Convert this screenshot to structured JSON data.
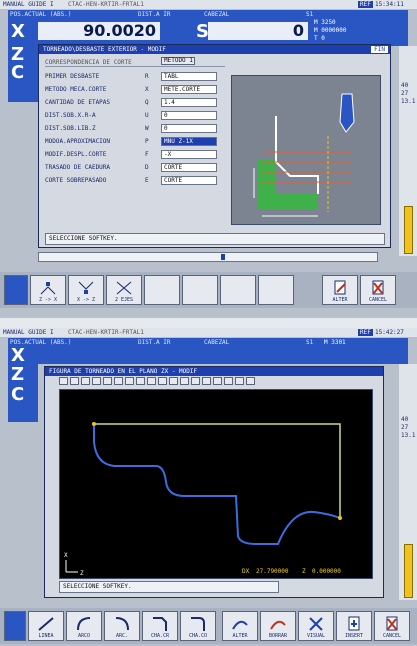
{
  "panel1": {
    "topbar": {
      "mode": "MANUAL GUIDE I",
      "program": "CTAC-HEN-KRTIR-FRTAL1",
      "badge": "REF",
      "time": "15:34:11"
    },
    "header": {
      "pos_label": "POS.ACTUAL (ABS.)",
      "dist_label": "DIST.A IR",
      "cabezal_label": "CABEZAL",
      "s_label": "S1",
      "x_axis": "X",
      "z_axis": "Z",
      "c_axis": "C",
      "x_value": "90.0020",
      "s_axis": "S",
      "s_value": "0",
      "s_info1": "M 3250",
      "s_info2": "M 0000000",
      "s_info3": "T 0"
    },
    "dialog": {
      "title": "TORNEADO\\DESBASTE EXTERIOR - MODIF",
      "title_badge": "FIN",
      "section": "CORRESPONDENCIA DE CORTE",
      "section_value": "METODO 1",
      "rows": [
        {
          "label": "PRIMER DESBASTE",
          "key": "R",
          "value": "TABL"
        },
        {
          "label": "METODO MECA.CORTE",
          "key": "X",
          "value": "METE.CORTE"
        },
        {
          "label": "CANTIDAD DE ETAPAS",
          "key": "Q",
          "value": "1.4"
        },
        {
          "label": "DIST.SOB.X.R-A",
          "key": "U",
          "value": "0"
        },
        {
          "label": "DIST.SOB.LIB.Z",
          "key": "W",
          "value": "0"
        },
        {
          "label": "MODOA.APROXIMACION",
          "key": "P",
          "value": "MNU Z-1X",
          "selected": true
        },
        {
          "label": "MODIF.DESPL.CORTE",
          "key": "F",
          "value": "-X"
        },
        {
          "label": "TRASADO DE CAEDURA",
          "key": "D",
          "value": "CORTE"
        },
        {
          "label": "CORTE SOBREPASADO",
          "key": "E",
          "value": "CORTE"
        }
      ],
      "status": "SELECCIONE SOFTKEY."
    },
    "side_numbers": [
      "40",
      "27",
      "13.1"
    ],
    "softkeys": [
      {
        "label": "Z -> X",
        "icon": "turn-z-x-icon"
      },
      {
        "label": "X -> Z",
        "icon": "turn-x-z-icon"
      },
      {
        "label": "2 EJES",
        "icon": "two-axes-icon"
      },
      {
        "label": "",
        "icon": ""
      },
      {
        "label": "",
        "icon": ""
      },
      {
        "label": "",
        "icon": ""
      },
      {
        "label": "",
        "icon": ""
      },
      {
        "label": "ALTER",
        "icon": "alter-icon"
      },
      {
        "label": "CANCEL",
        "icon": "cancel-icon"
      }
    ]
  },
  "panel2": {
    "topbar": {
      "mode": "MANUAL GUIDE I",
      "program": "CTAC-HEN-KRTIR-FRTAL1",
      "badge": "REF",
      "time": "15:42:27"
    },
    "header": {
      "pos_label": "POS.ACTUAL (ABS.)",
      "dist_label": "DIST.A IR",
      "cabezal_label": "CABEZAL",
      "s_label": "S1",
      "x_axis": "X",
      "z_axis": "Z",
      "c_axis": "C",
      "s_info1": "M 3301"
    },
    "dialog": {
      "title": "FIGURA DE TORNEADO EN EL PLANO ZX - MODIF",
      "coords_prefix": "DX",
      "coords_x": "27.790000",
      "coords_z_label": "Z",
      "coords_z": "0.000000",
      "status": "SELECCIONE SOFTKEY.",
      "axis_x": "X",
      "axis_z": "Z"
    },
    "side_numbers": [
      "40",
      "27",
      "13.1"
    ],
    "softkeys": [
      {
        "label": "LINEA",
        "icon": "line-icon"
      },
      {
        "label": "ARCO",
        "icon": "arc-cw-icon"
      },
      {
        "label": "ARC.",
        "icon": "arc-ccw-icon"
      },
      {
        "label": "CHA.CR",
        "icon": "chamfer-icon"
      },
      {
        "label": "CHA.CO",
        "icon": "corner-icon"
      },
      {
        "label": "ALTER",
        "icon": "alter-curve-icon"
      },
      {
        "label": "BORRAR",
        "icon": "delete-icon"
      },
      {
        "label": "VISUAL",
        "icon": "visual-icon"
      },
      {
        "label": "INSERT",
        "icon": "insert-icon"
      },
      {
        "label": "CANCEL",
        "icon": "cancel-icon"
      }
    ]
  }
}
